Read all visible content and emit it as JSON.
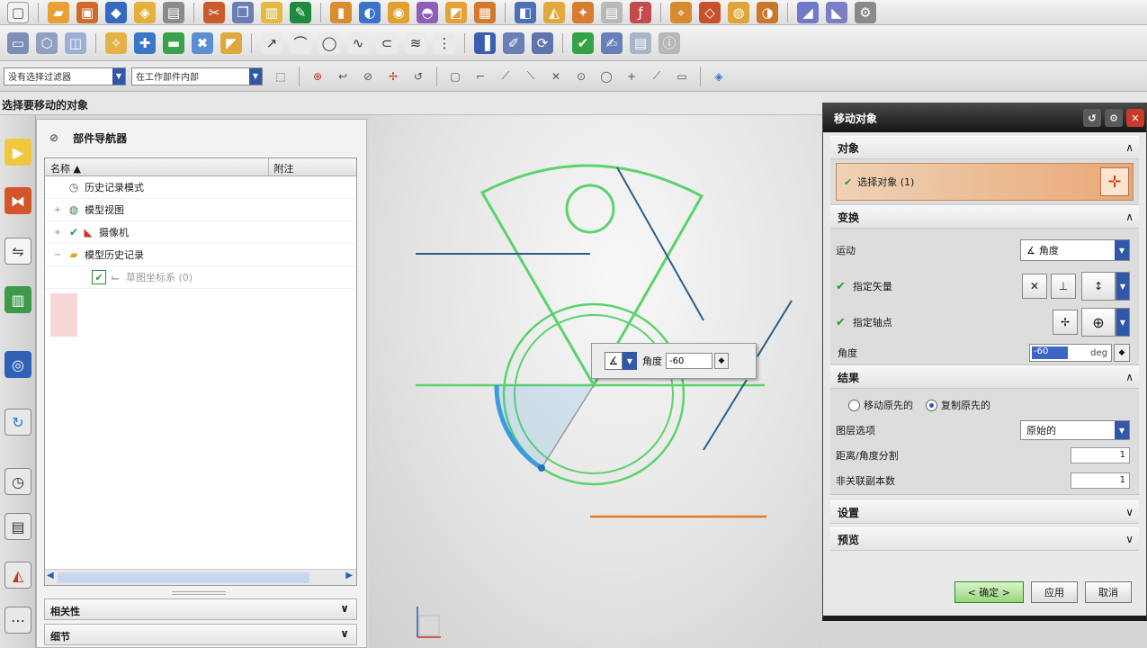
{
  "status_prompt": "选择要移动的对象",
  "toolbar3": {
    "selection_filter": "没有选择过滤器",
    "scope": "在工作部件内部"
  },
  "navigator": {
    "title": "部件导航器",
    "columns": [
      "名称",
      "附注"
    ],
    "items": [
      {
        "label": "历史记录模式",
        "icon": "clock-icon"
      },
      {
        "label": "模型视图",
        "icon": "views-icon"
      },
      {
        "label": "摄像机",
        "icon": "camera-icon"
      },
      {
        "label": "模型历史记录",
        "icon": "folder-icon"
      },
      {
        "label": "草图坐标系 (0)",
        "icon": "datum-csys-icon"
      }
    ],
    "bottom_panels": [
      "相关性",
      "细节"
    ]
  },
  "float_input": {
    "label": "角度",
    "value": "-60"
  },
  "dialog": {
    "title": "移动对象",
    "sections": {
      "object": "对象",
      "transform": "变换",
      "result": "结果",
      "settings": "设置",
      "preview": "预览"
    },
    "select_object": "选择对象 (1)",
    "motion_label": "运动",
    "motion_value": "角度",
    "specify_vector": "指定矢量",
    "specify_axis_point": "指定轴点",
    "angle_label": "角度",
    "angle_value": "-60",
    "angle_unit": "deg",
    "result_options": [
      "移动原先的",
      "复制原先的"
    ],
    "result_selected": 1,
    "layer_option_label": "图层选项",
    "layer_option_value": "原始的",
    "distance_angle_division_label": "距离/角度分割",
    "distance_angle_division_value": "1",
    "non_associative_copies_label": "非关联副本数",
    "non_associative_copies_value": "1",
    "buttons": {
      "ok": "< 确定 >",
      "apply": "应用",
      "cancel": "取消"
    }
  }
}
